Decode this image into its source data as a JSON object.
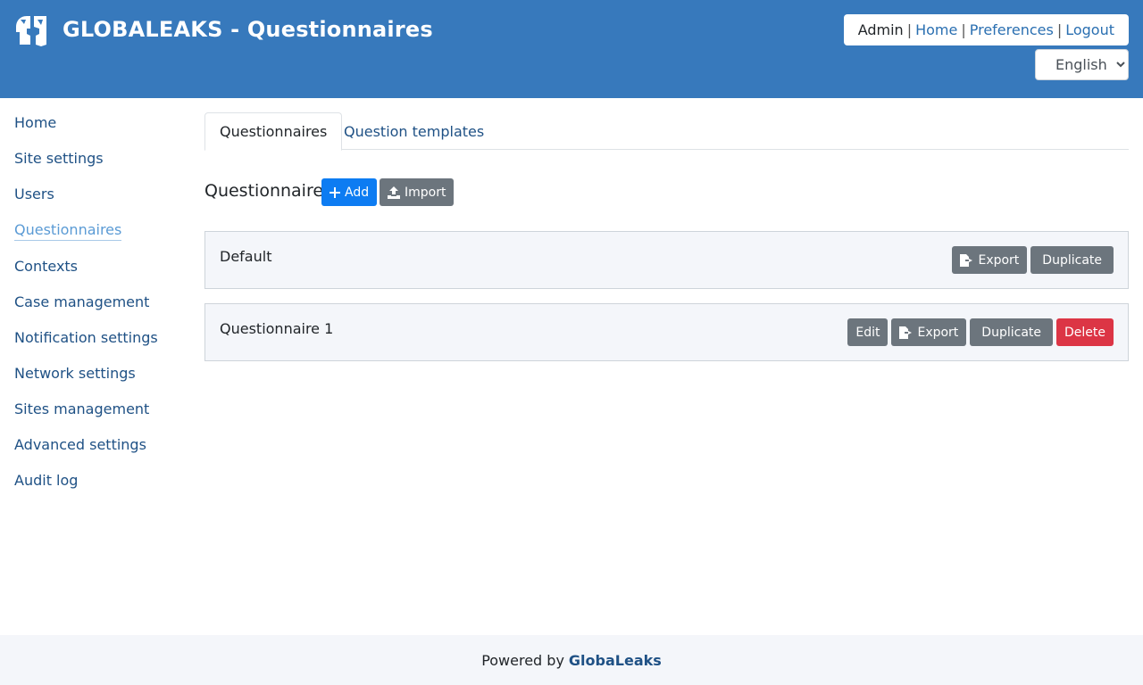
{
  "header": {
    "title": "GLOBALEAKS - Questionnaires",
    "user_role": "Admin",
    "links": [
      "Home",
      "Preferences",
      "Logout"
    ],
    "language": "English",
    "language_options": [
      "English"
    ],
    "background_color": "#3779bc"
  },
  "sidebar": {
    "items": [
      {
        "label": "Home",
        "active": false
      },
      {
        "label": "Site settings",
        "active": false
      },
      {
        "label": "Users",
        "active": false
      },
      {
        "label": "Questionnaires",
        "active": true
      },
      {
        "label": "Contexts",
        "active": false
      },
      {
        "label": "Case management",
        "active": false
      },
      {
        "label": "Notification settings",
        "active": false
      },
      {
        "label": "Network settings",
        "active": false
      },
      {
        "label": "Sites management",
        "active": false
      },
      {
        "label": "Advanced settings",
        "active": false
      },
      {
        "label": "Audit log",
        "active": false
      }
    ]
  },
  "tabs": [
    {
      "label": "Questionnaires",
      "active": true
    },
    {
      "label": "Question templates",
      "active": false
    }
  ],
  "section": {
    "title": "Questionnaires",
    "add_label": "Add",
    "import_label": "Import"
  },
  "questionnaires": [
    {
      "name": "Default",
      "export_label": "Export",
      "duplicate_label": "Duplicate"
    },
    {
      "name": "Questionnaire 1",
      "edit_label": "Edit",
      "export_label": "Export",
      "duplicate_label": "Duplicate",
      "delete_label": "Delete"
    }
  ],
  "footer": {
    "powered_by": "Powered by",
    "brand": "GlobaLeaks"
  },
  "colors": {
    "primary": "#0d7cf2",
    "secondary": "#6c757d",
    "danger": "#dc3545",
    "link": "#1f5185"
  }
}
